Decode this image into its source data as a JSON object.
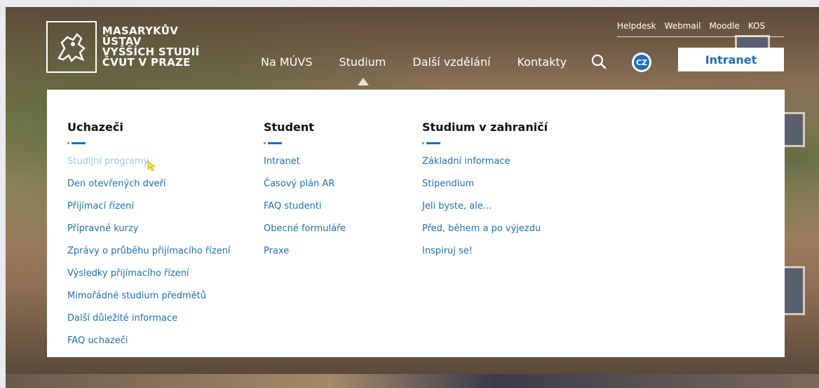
{
  "logo": {
    "line1": "MASARYKŮV ÚSTAV",
    "line2": "VYŠŠÍCH STUDIÍ",
    "line3": "ČVUT V PRAZE"
  },
  "toplinks": [
    "Helpdesk",
    "Webmail",
    "Moodle",
    "KOS"
  ],
  "mainnav": [
    "Na MÚVS",
    "Studium",
    "Další vzdělání",
    "Kontakty"
  ],
  "lang": "CZ",
  "intranet_label": "Intranet",
  "menu": {
    "col1": {
      "title": "Uchazeči",
      "items": [
        "Studijní programy",
        "Den otevřených dveří",
        "Přijímací řízení",
        "Přípravné kurzy",
        "Zprávy o průběhu přijímacího řízení",
        "Výsledky přijímacího řízení",
        "Mimořádné studium předmětů",
        "Další důležité informace",
        "FAQ uchazeči"
      ]
    },
    "col2": {
      "title": "Student",
      "items": [
        "Intranet",
        "Časový plán AR",
        "FAQ studenti",
        "Obecné formuláře",
        "Praxe"
      ]
    },
    "col3": {
      "title": "Studium v zahraničí",
      "items": [
        "Základní informace",
        "Stipendium",
        "Jeli byste, ale...",
        "Před, během a po výjezdu",
        "Inspiruj se!"
      ]
    }
  },
  "colors": {
    "link": "#1f6fb5",
    "link_hover": "#9fc5e8",
    "accent_orange": "#c48a4a"
  },
  "icons": {
    "search": "search-icon",
    "logo": "lion-logo-icon",
    "cursor": "mouse-cursor-icon"
  }
}
